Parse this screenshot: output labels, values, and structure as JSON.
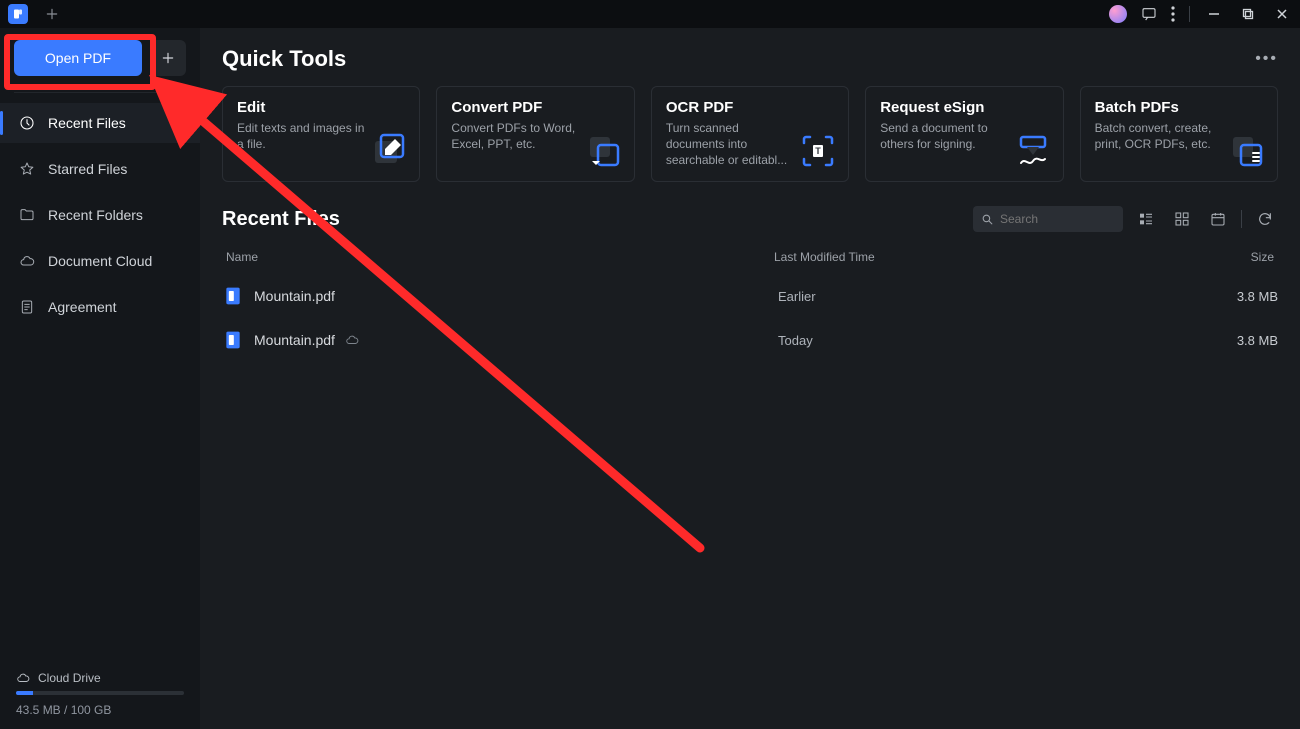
{
  "titlebar": {
    "new_tab_icon": "plus-icon"
  },
  "open_pdf": {
    "label": "Open PDF"
  },
  "sidebar": {
    "items": [
      {
        "label": "Recent Files"
      },
      {
        "label": "Starred Files"
      },
      {
        "label": "Recent Folders"
      },
      {
        "label": "Document Cloud"
      },
      {
        "label": "Agreement"
      }
    ],
    "cloud_label": "Cloud Drive",
    "storage_text": "43.5 MB / 100 GB"
  },
  "quick_tools": {
    "heading": "Quick Tools",
    "cards": [
      {
        "title": "Edit",
        "desc": "Edit texts and images in a file."
      },
      {
        "title": "Convert PDF",
        "desc": "Convert PDFs to Word, Excel, PPT, etc."
      },
      {
        "title": "OCR PDF",
        "desc": "Turn scanned documents into searchable or editabl..."
      },
      {
        "title": "Request eSign",
        "desc": "Send a document to others for signing."
      },
      {
        "title": "Batch PDFs",
        "desc": "Batch convert, create, print, OCR PDFs, etc."
      }
    ]
  },
  "recent_files": {
    "heading": "Recent Files",
    "search_placeholder": "Search",
    "columns": {
      "name": "Name",
      "time": "Last Modified Time",
      "size": "Size"
    },
    "rows": [
      {
        "name": "Mountain.pdf",
        "time": "Earlier",
        "size": "3.8 MB",
        "cloud": false
      },
      {
        "name": "Mountain.pdf",
        "time": "Today",
        "size": "3.8 MB",
        "cloud": true
      }
    ]
  }
}
